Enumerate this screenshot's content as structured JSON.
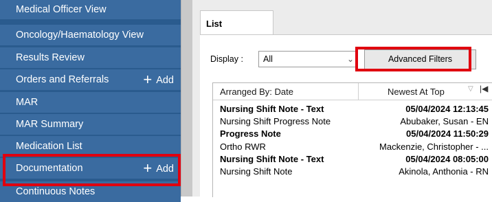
{
  "sidebar": {
    "items": [
      {
        "label": "Medical Officer View"
      },
      {
        "label": "Oncology/Haematology View"
      },
      {
        "label": "Results Review"
      },
      {
        "label": "Orders and Referrals",
        "add_label": "Add"
      },
      {
        "label": "MAR"
      },
      {
        "label": "MAR Summary"
      },
      {
        "label": "Medication List"
      },
      {
        "label": "Documentation",
        "add_label": "Add"
      },
      {
        "label": "Continuous Notes"
      }
    ],
    "highlighted": "Documentation"
  },
  "tabs": [
    {
      "label": "List"
    }
  ],
  "toolbar": {
    "display_label": "Display :",
    "display_value": "All",
    "advanced_filters_label": "Advanced Filters"
  },
  "list": {
    "header": {
      "left": "Arranged By: Date",
      "right": "Newest At Top"
    },
    "rows": [
      {
        "c1": "Nursing Shift Note - Text",
        "c2": "05/04/2024 12:13:45",
        "bold": true
      },
      {
        "c1": "Nursing Shift Progress Note",
        "c2": "Abubaker, Susan  - EN",
        "bold": false
      },
      {
        "c1": "Progress Note",
        "c2": "05/04/2024 11:50:29",
        "bold": true
      },
      {
        "c1": "Ortho RWR",
        "c2": "Mackenzie, Christopher  - ...",
        "bold": false
      },
      {
        "c1": "Nursing Shift Note - Text",
        "c2": "05/04/2024 08:05:00",
        "bold": true
      },
      {
        "c1": "Nursing Shift Note",
        "c2": "Akinola, Anthonia - RN",
        "bold": false
      }
    ]
  },
  "colors": {
    "sidebar_bg": "#2a5b8e",
    "nav_item_bg": "#3a6ba0",
    "highlight_border": "#e0000f"
  }
}
